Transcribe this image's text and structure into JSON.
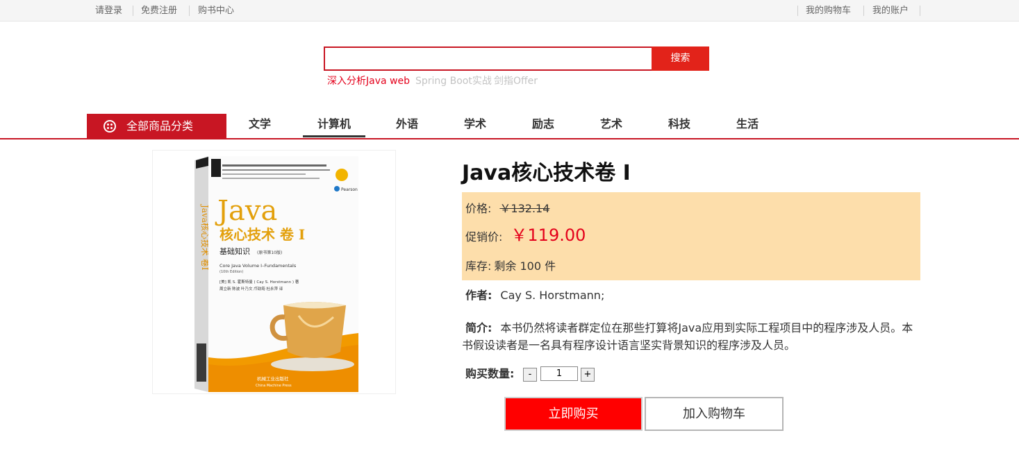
{
  "topbar": {
    "login": "请登录",
    "register": "免费注册",
    "book_center": "购书中心",
    "my_cart": "我的购物车",
    "my_account": "我的账户"
  },
  "search": {
    "value": "",
    "button": "搜索",
    "hot_words": [
      "深入分析Java web",
      "Spring Boot实战",
      "剑指Offer"
    ]
  },
  "nav": {
    "all_categories": "全部商品分类",
    "items": [
      "文学",
      "计算机",
      "外语",
      "学术",
      "励志",
      "艺术",
      "科技",
      "生活"
    ],
    "active_item": "计算机"
  },
  "product": {
    "title": "Java核心技术卷 I",
    "price_label": "价格:",
    "original_price": "￥132.14",
    "promo_label": "促销价:",
    "promo_price": "￥119.00",
    "stock_label": "库存:",
    "stock_value": "剩余 100 件",
    "author_label": "作者:",
    "author": "Cay S. Horstmann;",
    "intro_label": "简介:",
    "intro": "本书仍然将读者群定位在那些打算将Java应用到实际工程项目中的程序涉及人员。本书假设读者是一名具有程序设计语言坚实背景知识的程序涉及人员。",
    "qty_label": "购买数量:",
    "qty_minus": "-",
    "qty_value": "1",
    "qty_plus": "+",
    "buy_now": "立即购买",
    "add_to_cart": "加入购物车"
  },
  "cover": {
    "series": "Java",
    "title_cn": "核心技术 卷 I",
    "subtitle_cn": "基础知识",
    "edition_cn": "(原书第10版)",
    "title_en": "Core Java Volume I–Fundamentals",
    "edition_en": "(10th Edition)",
    "authors_line1": "[美] 凯 S. 霍斯特曼 ( Cay S. Horstmann ) 著",
    "authors_line2": "周立新 陈波 叶乃文 邝劲筠 杜永萍 译",
    "publisher": "机械工业出版社",
    "publisher_en": "China Machine Press",
    "brand": "Pearson",
    "spine": "Java核心技术 卷I"
  },
  "colors": {
    "brand_red": "#c81623",
    "price_red": "#e4001b",
    "panel_bg": "#fddeab",
    "buy_red": "#ff0000"
  }
}
